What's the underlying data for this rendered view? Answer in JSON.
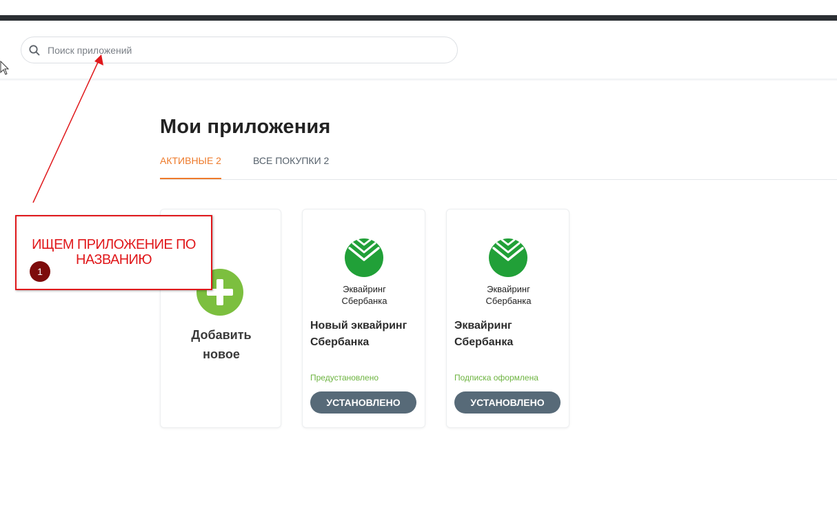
{
  "search": {
    "placeholder": "Поиск приложений",
    "icon": "search-icon"
  },
  "page": {
    "title": "Мои приложения"
  },
  "tabs": [
    {
      "label": "АКТИВНЫЕ 2",
      "active": true
    },
    {
      "label": "ВСЕ ПОКУПКИ 2",
      "active": false
    }
  ],
  "add_card": {
    "label_line1": "Добавить",
    "label_line2": "новое",
    "icon": "plus-icon"
  },
  "apps": [
    {
      "logo_line1": "Эквайринг",
      "logo_line2": "Сбербанка",
      "name_line1": "Новый эквайринг",
      "name_line2": "Сбербанка",
      "status": "Предустановлено",
      "button": "УСТАНОВЛЕНО"
    },
    {
      "logo_line1": "Эквайринг",
      "logo_line2": "Сбербанка",
      "name_line1": "Эквайринг",
      "name_line2": "Сбербанка",
      "status": "Подписка оформлена",
      "button": "УСТАНОВЛЕНО"
    }
  ],
  "annotation": {
    "line1": "ИЩЕМ ПРИЛОЖЕНИЕ ПО",
    "line2": "НАЗВАНИЮ",
    "step": "1"
  },
  "colors": {
    "accent": "#ee7a2a",
    "sber_green": "#21a038",
    "add_green": "#7cbf3f",
    "status_green": "#6cb33f",
    "button": "#576a78",
    "annotation_red": "#e0181b",
    "badge": "#7d0b0b"
  }
}
